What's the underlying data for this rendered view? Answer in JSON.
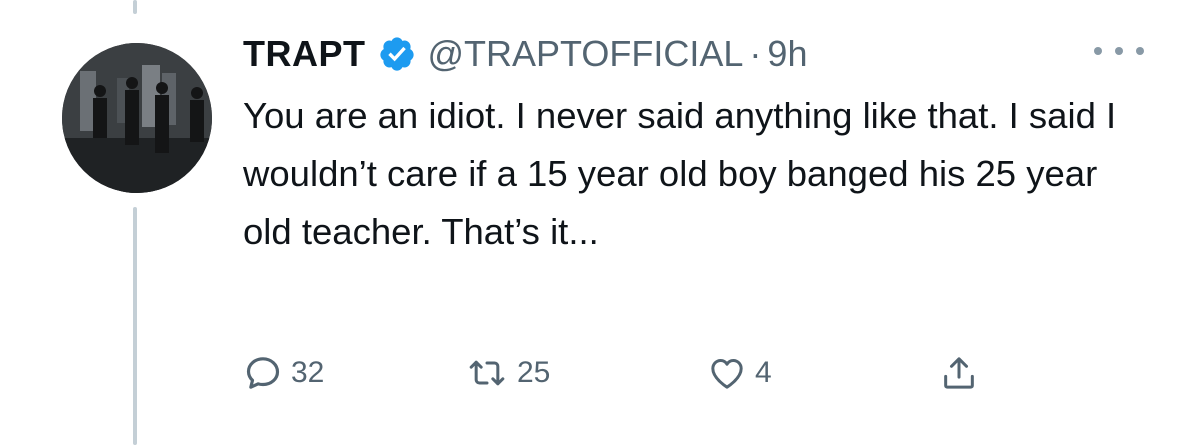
{
  "tweet": {
    "display_name": "TRAPT",
    "handle": "@TRAPTOFFICIAL",
    "separator": "·",
    "time": "9h",
    "text": "You are an idiot. I never said anything like that. I said I wouldn’t care if a 15 year old boy banged his 25 year old teacher. That’s it...",
    "verified": true,
    "verified_color": "#1d9bf0"
  },
  "actions": {
    "reply_count": "32",
    "retweet_count": "25",
    "like_count": "4"
  },
  "icons": {
    "verified": "verified-badge-icon",
    "more": "more-options-icon",
    "reply": "reply-icon",
    "retweet": "retweet-icon",
    "like": "heart-icon",
    "share": "share-icon"
  },
  "colors": {
    "text": "#0f1419",
    "secondary": "#536471",
    "thread_line": "#c4cfd6"
  }
}
